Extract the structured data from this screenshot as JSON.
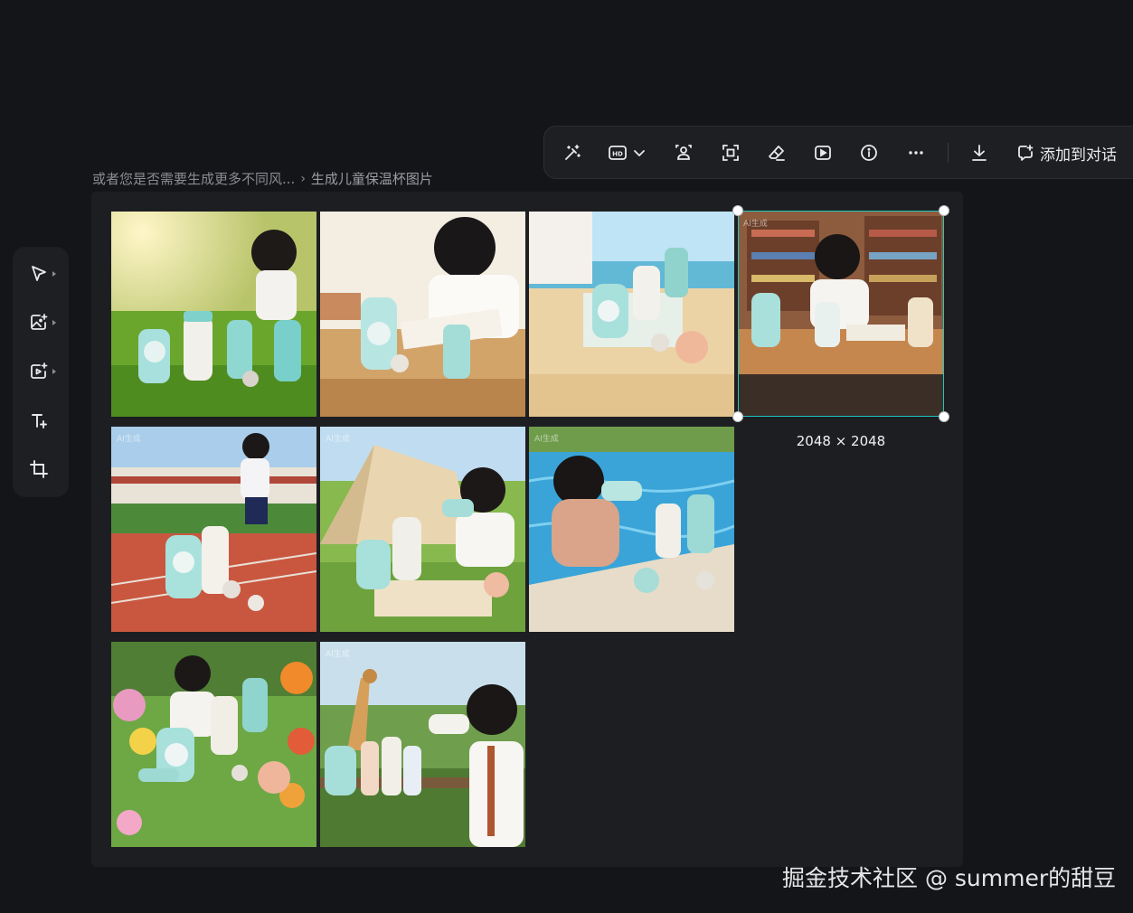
{
  "toolbar": {
    "buttons": [
      {
        "icon": "magic-wand-icon"
      },
      {
        "icon": "hd-upscale-icon"
      },
      {
        "icon": "person-cutout-icon"
      },
      {
        "icon": "expand-frame-icon"
      },
      {
        "icon": "eraser-icon"
      },
      {
        "icon": "play-video-icon"
      },
      {
        "icon": "info-icon"
      },
      {
        "icon": "more-icon"
      },
      {
        "icon": "download-icon"
      }
    ],
    "add_label": "添加到对话"
  },
  "breadcrumb": {
    "parent": "或者您是否需要生成更多不同风...",
    "separator": "›",
    "current": "生成儿童保温杯图片"
  },
  "rail": {
    "items": [
      {
        "icon": "select-cursor-icon"
      },
      {
        "icon": "image-add-icon"
      },
      {
        "icon": "video-add-icon"
      },
      {
        "icon": "text-tool-icon"
      },
      {
        "icon": "crop-tool-icon"
      }
    ]
  },
  "images": [
    {
      "scene": "meadow-sunrise",
      "tag": ""
    },
    {
      "scene": "study-desk",
      "tag": ""
    },
    {
      "scene": "beach",
      "tag": ""
    },
    {
      "scene": "library",
      "tag": "AI生成",
      "selected": true
    },
    {
      "scene": "running-track",
      "tag": "AI生成"
    },
    {
      "scene": "camping-tent",
      "tag": "AI生成"
    },
    {
      "scene": "swimming-pool",
      "tag": "AI生成"
    },
    {
      "scene": "flower-garden",
      "tag": ""
    },
    {
      "scene": "zoo-giraffe",
      "tag": "AI生成"
    }
  ],
  "selection": {
    "size_label": "2048 × 2048"
  },
  "watermark": "掘金技术社区 @ summer的甜豆",
  "colors": {
    "accent": "#1fc7c0",
    "panel": "#1d1e22",
    "background": "#141518"
  }
}
